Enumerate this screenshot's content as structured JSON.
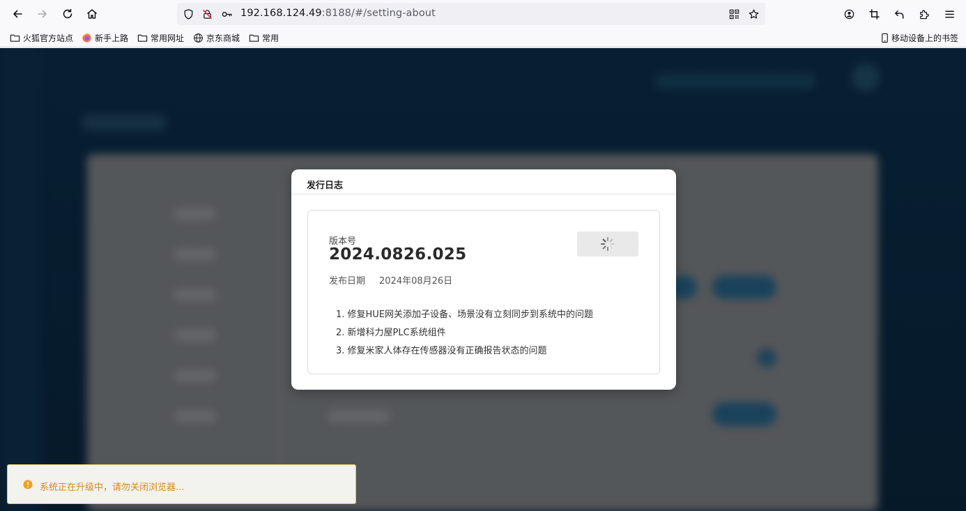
{
  "browser": {
    "url_host": "192.168.124.49",
    "url_rest": ":8188/#/setting-about",
    "bookmarks": [
      "火狐官方站点",
      "新手上路",
      "常用网址",
      "京东商城",
      "常用"
    ],
    "mobile_bookmarks": "移动设备上的书签"
  },
  "modal": {
    "title": "发行日志",
    "version_label": "版本号",
    "version": "2024.0826.025",
    "date_label": "发布日期",
    "date": "2024年08月26日",
    "notes": [
      "1. 修复HUE网关添加子设备、场景没有立刻同步到系统中的问题",
      "2. 新增科力屋PLC系统组件",
      "3. 修复米家人体存在传感器没有正确报告状态的问题"
    ]
  },
  "toast": {
    "message": "系统正在升级中，请勿关闭浏览器...",
    "color": "#d48a1d"
  },
  "icons": {
    "back": "arrow-left-icon",
    "forward": "arrow-right-icon",
    "reload": "reload-icon",
    "home": "home-icon",
    "shield": "shield-icon",
    "permissions": "blocked-permission-icon",
    "key": "key-icon",
    "qr": "qr-code-icon",
    "star": "star-icon",
    "account": "account-icon",
    "crop": "crop-icon",
    "undo": "undo-icon",
    "extensions": "puzzle-icon",
    "menu": "hamburger-menu-icon",
    "spinner": "loading-spinner-icon",
    "warning": "warning-icon"
  }
}
